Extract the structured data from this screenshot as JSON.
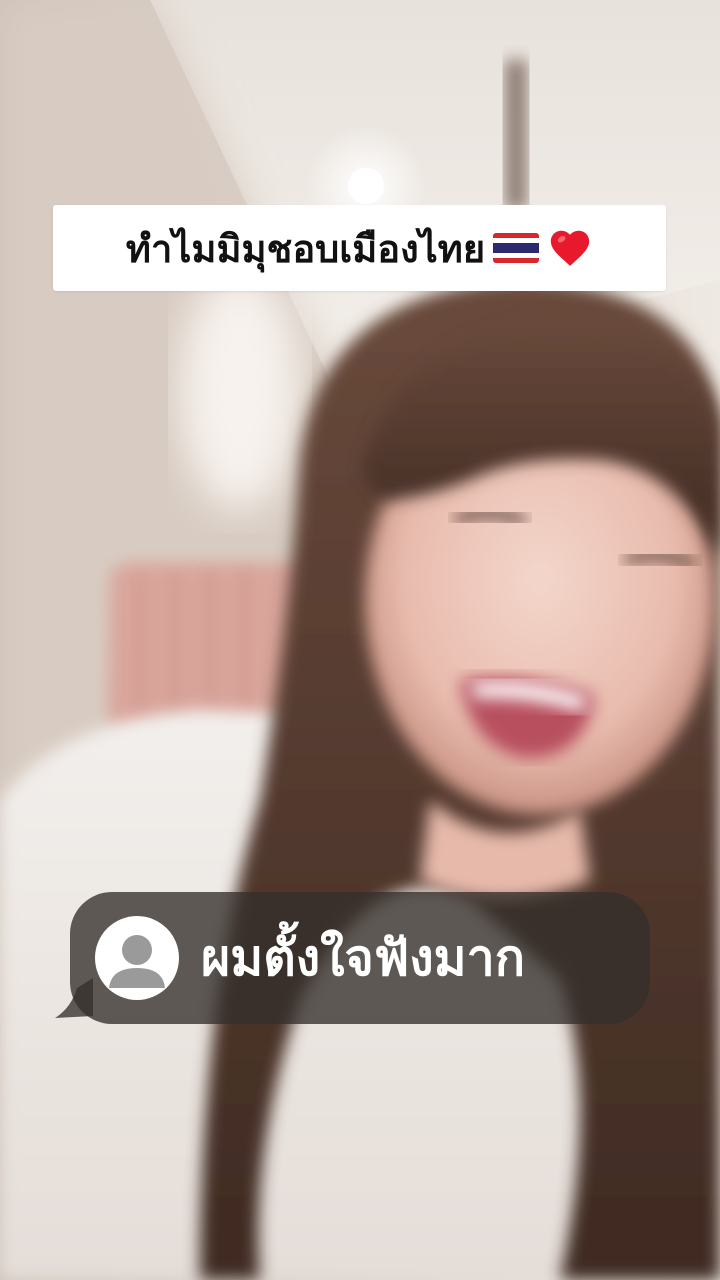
{
  "video": {
    "title_caption": "ทำไมมิมุชอบเมืองไทย",
    "title_emojis": [
      "thailand-flag-icon",
      "red-heart-icon"
    ],
    "comment": {
      "avatar_icon": "default-user-icon",
      "text": "ผมตั้งใจฟังมาก"
    }
  },
  "colors": {
    "caption_bg": "#ffffff",
    "caption_text": "#111111",
    "bubble_bg": "#34302c",
    "bubble_text": "#ffffff",
    "heart": "#e8192c",
    "flag_red": "#d8262e",
    "flag_blue": "#2d2a6e"
  }
}
